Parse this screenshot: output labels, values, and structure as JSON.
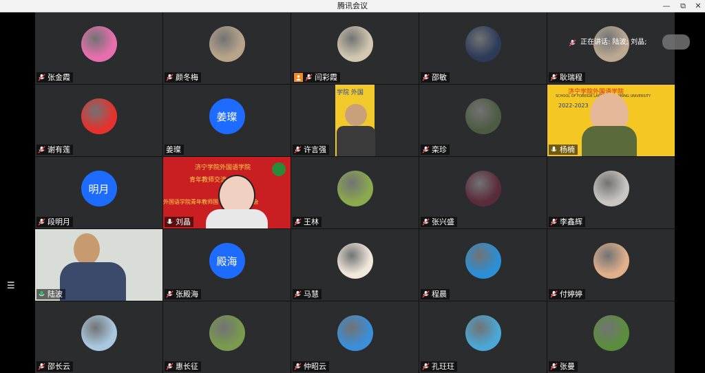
{
  "window": {
    "title": "腾讯会议",
    "buttons": [
      "—",
      "⧉",
      "✕"
    ]
  },
  "speaking": {
    "label": "正在讲话: 陆波; 刘晶;"
  },
  "participants": [
    {
      "name": "张金霞",
      "type": "avatar",
      "avatar_color": "#e86fae"
    },
    {
      "name": "颜冬梅",
      "type": "avatar",
      "avatar_color": "#b9a48a"
    },
    {
      "name": "闫彩霞",
      "type": "avatar",
      "avatar_color": "#d2c8b0",
      "badge": "user-icon"
    },
    {
      "name": "邵敏",
      "type": "avatar",
      "avatar_color": "#2c3b5a"
    },
    {
      "name": "耿瑞程",
      "type": "avatar",
      "avatar_color": "#bca992"
    },
    {
      "name": "谢有莲",
      "type": "avatar",
      "avatar_color": "#e5322d"
    },
    {
      "name": "姜璨",
      "type": "text-avatar",
      "initials": "姜璨"
    },
    {
      "name": "许言强",
      "type": "video",
      "bg": "#f2c92b"
    },
    {
      "name": "栾珍",
      "type": "avatar",
      "avatar_color": "#4e5b43"
    },
    {
      "name": "杨楠",
      "type": "video",
      "bg": "#f5c722"
    },
    {
      "name": "段明月",
      "type": "text-avatar",
      "initials": "明月"
    },
    {
      "name": "刘晶",
      "type": "video",
      "bg": "#c91f22"
    },
    {
      "name": "王林",
      "type": "avatar",
      "avatar_color": "#8ba94d"
    },
    {
      "name": "张兴盛",
      "type": "avatar",
      "avatar_color": "#5a2b3a"
    },
    {
      "name": "李鑫辉",
      "type": "avatar",
      "avatar_color": "#c9c5c0"
    },
    {
      "name": "陆波",
      "type": "video",
      "bg": "#d8ddd8",
      "active": true
    },
    {
      "name": "张殿海",
      "type": "text-avatar",
      "initials": "殿海"
    },
    {
      "name": "马慧",
      "type": "avatar",
      "avatar_color": "#f1e8dc"
    },
    {
      "name": "程晨",
      "type": "avatar",
      "avatar_color": "#2a8fd6"
    },
    {
      "name": "付婷婷",
      "type": "avatar",
      "avatar_color": "#e0b08a"
    },
    {
      "name": "邵长云",
      "type": "avatar",
      "avatar_color": "#a9c8e0"
    },
    {
      "name": "惠长征",
      "type": "avatar",
      "avatar_color": "#7a9a4d"
    },
    {
      "name": "仲昭云",
      "type": "avatar",
      "avatar_color": "#3a8fd8"
    },
    {
      "name": "孔玨玨",
      "type": "avatar",
      "avatar_color": "#4aa7d6"
    },
    {
      "name": "张曼",
      "type": "avatar",
      "avatar_color": "#5b8e3c"
    }
  ],
  "video_texts": {
    "xu": "学院 外国",
    "yang_banner": "济宁学院外国语学院",
    "yang_sub": "SCHOOL OF FOREIGN LANGUAGES · JINING UNIVERSITY",
    "yang_year": "2022-2023",
    "liu_line1": "济宁学院外国语学院",
    "liu_line2": "青年教师交流    四期",
    "liu_line3": "外国语学院青年教师国        经验分享交流会"
  }
}
